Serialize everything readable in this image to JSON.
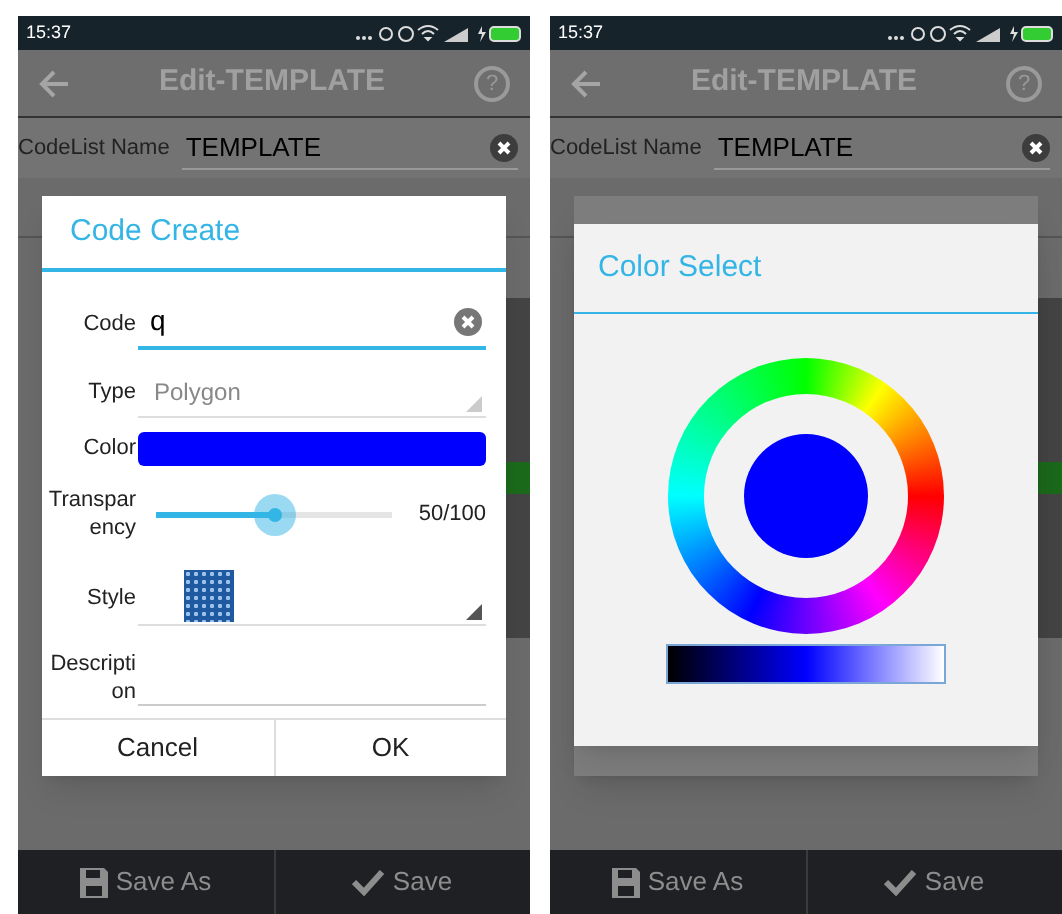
{
  "screens": [
    {
      "status_bar": {
        "time": "15:37"
      },
      "app_bar": {
        "title": "Edit-TEMPLATE",
        "help": "?"
      },
      "codelist_name": {
        "label": "CodeList Name",
        "value": "TEMPLATE"
      },
      "dialog": {
        "kind": "code_create",
        "title": "Code Create",
        "fields": [
          {
            "kind": "text",
            "label": "Code",
            "value": "q"
          },
          {
            "kind": "dropdown",
            "label": "Type",
            "value": "Polygon"
          },
          {
            "kind": "color",
            "label": "Color",
            "color": "#0000ff"
          },
          {
            "kind": "slider",
            "label": "Transparency",
            "level": 0.5,
            "reading": "50/100"
          },
          {
            "kind": "pattern",
            "label": "Style"
          },
          {
            "kind": "textarea",
            "label": "Description"
          }
        ],
        "buttons": [
          "Cancel",
          "OK"
        ]
      },
      "bottom_bar": {
        "buttons": [
          {
            "kind": "save_as",
            "label": "Save As"
          },
          {
            "kind": "save",
            "label": "Save"
          }
        ]
      }
    },
    {
      "status_bar": {
        "time": "15:37"
      },
      "app_bar": {
        "title": "Edit-TEMPLATE",
        "help": "?"
      },
      "codelist_name": {
        "label": "CodeList Name",
        "value": "TEMPLATE"
      },
      "dialog": {
        "kind": "color_select",
        "title": "Color Select",
        "color": "#0000ff"
      },
      "bottom_bar": {
        "buttons": [
          {
            "kind": "save_as",
            "label": "Save As"
          },
          {
            "kind": "save",
            "label": "Save"
          }
        ]
      }
    }
  ]
}
